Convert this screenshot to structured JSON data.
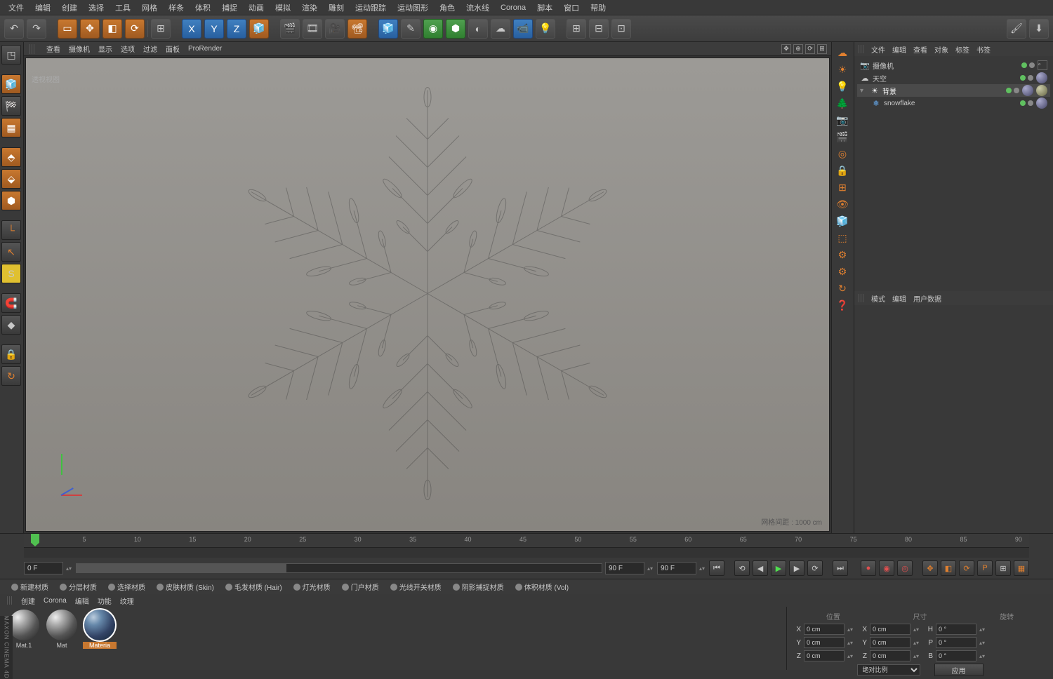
{
  "menu": [
    "文件",
    "编辑",
    "创建",
    "选择",
    "工具",
    "网格",
    "样条",
    "体积",
    "捕捉",
    "动画",
    "模拟",
    "渲染",
    "雕刻",
    "运动跟踪",
    "运动图形",
    "角色",
    "流水线",
    "Corona",
    "脚本",
    "窗口",
    "帮助"
  ],
  "viewport": {
    "menu": [
      "查看",
      "摄像机",
      "显示",
      "选项",
      "过滤",
      "面板",
      "ProRender"
    ],
    "label": "透视视图",
    "grid_info": "网格间距 : 1000 cm"
  },
  "objects": {
    "menu": [
      "文件",
      "编辑",
      "查看",
      "对象",
      "标签",
      "书签"
    ],
    "items": [
      {
        "icon": "📷",
        "name": "摄像机",
        "indent": 0
      },
      {
        "icon": "☁",
        "name": "天空",
        "indent": 0
      },
      {
        "icon": "☀",
        "name": "背景",
        "indent": 0,
        "sel": true
      },
      {
        "icon": "❄",
        "name": "snowflake",
        "indent": 1
      }
    ]
  },
  "attributes": {
    "menu": [
      "模式",
      "编辑",
      "用户数据"
    ]
  },
  "timeline": {
    "marks": [
      "0",
      "5",
      "10",
      "15",
      "20",
      "25",
      "30",
      "35",
      "40",
      "45",
      "50",
      "55",
      "60",
      "65",
      "70",
      "75",
      "80",
      "85",
      "90"
    ],
    "start": "0 F",
    "current": "0 F",
    "range_end": "90 F",
    "end": "90 F",
    "zero": "0 F"
  },
  "materials": {
    "types": [
      "新建材质",
      "分层材质",
      "选择材质",
      "皮肤材质 (Skin)",
      "毛发材质 (Hair)",
      "灯光材质",
      "门户材质",
      "光线开关材质",
      "阴影捕捉材质",
      "体积材质 (Vol)"
    ],
    "menu": [
      "创建",
      "Corona",
      "编辑",
      "功能",
      "纹理"
    ],
    "balls": [
      {
        "name": "Mat.1"
      },
      {
        "name": "Mat"
      },
      {
        "name": "Materia",
        "blue": true,
        "sel": true
      }
    ]
  },
  "coords": {
    "header_left": "位置",
    "header_mid": "尺寸",
    "header_right": "旋转",
    "rows": [
      {
        "axis": "X",
        "pos": "0 cm",
        "size": "0 cm",
        "rot": "0 °",
        "rlabel": "H"
      },
      {
        "axis": "Y",
        "pos": "0 cm",
        "size": "0 cm",
        "rot": "0 °",
        "rlabel": "P"
      },
      {
        "axis": "Z",
        "pos": "0 cm",
        "size": "0 cm",
        "rot": "0 °",
        "rlabel": "B"
      }
    ],
    "mode": "绝对比例",
    "apply": "应用"
  },
  "logo": "MAXON CINEMA 4D"
}
